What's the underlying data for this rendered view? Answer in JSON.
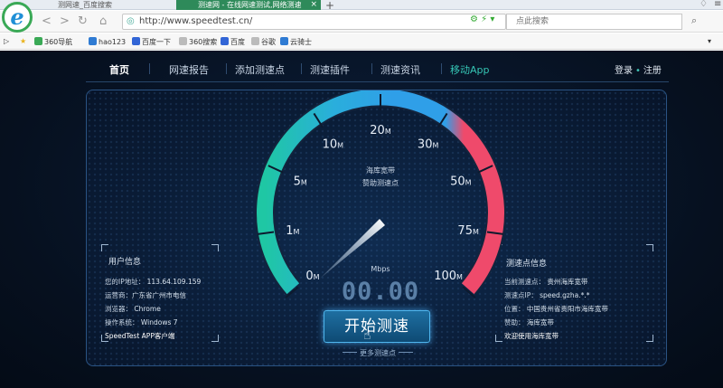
{
  "browser": {
    "tabs": [
      {
        "label": "测网速_百度搜索",
        "active": false
      },
      {
        "label": "测速网 - 在线网速测试,网络测速",
        "active": true
      }
    ],
    "address": "http://www.speedtest.cn/",
    "search_placeholder": "点此搜索",
    "favorites": [
      "360导航",
      "hao123",
      "百度一下",
      "360搜索",
      "百度",
      "谷歌",
      "云骑士"
    ]
  },
  "site": {
    "nav": [
      "首页",
      "网速报告",
      "添加测速点",
      "测速插件",
      "测速资讯",
      "移动App"
    ],
    "login": "登录",
    "register": "注册"
  },
  "user_info": {
    "title": "用户信息",
    "rows": [
      {
        "label": "您的IP地址：",
        "value": "113.64.109.159"
      },
      {
        "label": "运营商：",
        "value": "广东省广州市电信"
      },
      {
        "label": "浏览器：",
        "value": "Chrome"
      },
      {
        "label": "操作系统：",
        "value": "Windows 7"
      }
    ],
    "app_link": "SpeedTest APP客户端"
  },
  "node_info": {
    "title": "测速点信息",
    "rows": [
      {
        "label": "当前测速点：",
        "value": "贵州海库宽带"
      },
      {
        "label": "测速点IP：",
        "value": "speed.gzha.*.*"
      },
      {
        "label": "位置：",
        "value": "中国贵州省贵阳市海库宽带"
      },
      {
        "label": "赞助：",
        "value": "海库宽带"
      }
    ],
    "welcome": "欢迎使用海库宽带"
  },
  "gauge": {
    "ticks": [
      {
        "num": "0",
        "unit": "M"
      },
      {
        "num": "1",
        "unit": "M"
      },
      {
        "num": "5",
        "unit": "M"
      },
      {
        "num": "10",
        "unit": "M"
      },
      {
        "num": "20",
        "unit": "M"
      },
      {
        "num": "30",
        "unit": "M"
      },
      {
        "num": "50",
        "unit": "M"
      },
      {
        "num": "75",
        "unit": "M"
      },
      {
        "num": "100",
        "unit": "M"
      }
    ],
    "sponsor_line1": "海库宽带",
    "sponsor_line2": "赞助测速点",
    "unit": "Mbps",
    "speed": "00.00",
    "colors": {
      "teal": "#1fc7a4",
      "blue": "#2f9fe8",
      "red": "#ef4a6b"
    }
  },
  "actions": {
    "start": "开始测速",
    "more_nodes": "更多测速点"
  }
}
